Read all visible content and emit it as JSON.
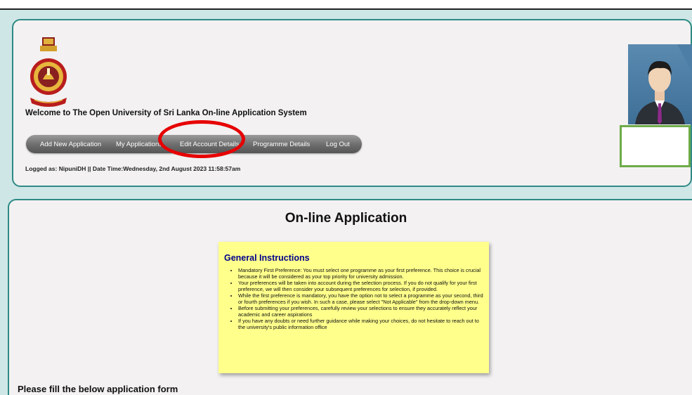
{
  "header": {
    "logo_caption": "logo",
    "welcome_text": "Welcome to The Open University of Sri Lanka On-line Application System",
    "nav": [
      {
        "label": "Add New Application"
      },
      {
        "label": "My Applications"
      },
      {
        "label": "Edit Account Details"
      },
      {
        "label": "Programme Details"
      },
      {
        "label": "Log Out"
      }
    ],
    "logged_text": "Logged as: NipuniDH || Date Time:Wednesday, 2nd August 2023 11:58:57am",
    "highlight_color": "#e60000"
  },
  "profile": {
    "avatar_icon": "user-avatar-icon",
    "photo_frame_color": "#6dab49"
  },
  "main": {
    "title": "On-line Application",
    "instructions": {
      "heading": "General Instructions",
      "items": [
        "Mandatory First Preference: You must select one programme as your first preference. This choice is crucial because it will be considered as your top priority for university admission.",
        "Your preferences will be taken into account during the selection process. If you do not qualify for your first preference, we will then consider your subsequent preferences for selection, if provided.",
        "While the first preference is mandatory, you have the option not to select a programme as your second, third or fourth preferences if you wish. In such a case, please select \"Not Applicable\" from the drop-down menu.",
        "Before submitting your preferences, carefully review your selections to ensure they accurately reflect your academic and career aspirations",
        "If you have any doubts or need further guidance while making your choices, do not hesitate to reach out to the university's public information office"
      ]
    },
    "form_heading": "Please fill the below application form"
  }
}
